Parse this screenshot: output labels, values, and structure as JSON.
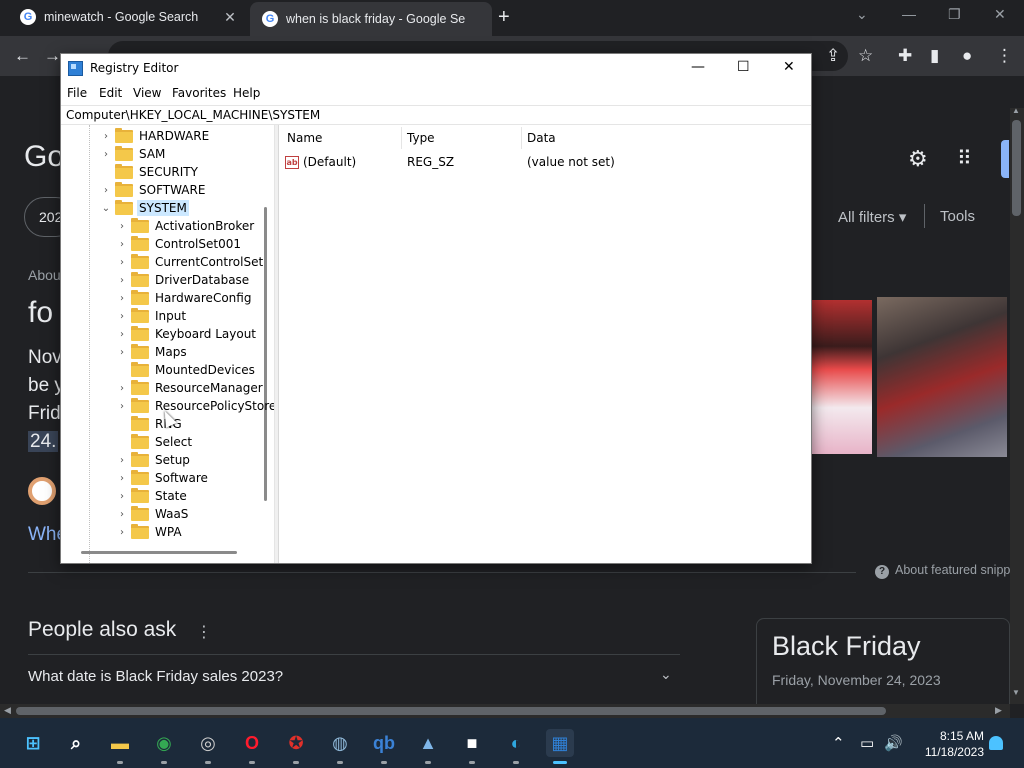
{
  "browser": {
    "tabs": [
      {
        "title": "minewatch - Google Search",
        "favicon": "G"
      },
      {
        "title": "when is black friday - Google Se",
        "favicon": "G"
      }
    ],
    "new_tab": "+",
    "window_controls": {
      "dropdown": "⌄",
      "minimize": "—",
      "restore": "❐",
      "close": "✕"
    },
    "toolbar_icons": {
      "back": "←",
      "forward": "→",
      "share": "⇪",
      "star": "☆",
      "extensions": "✚",
      "sidepanel": "▮",
      "profile": "●",
      "menu": "⋮"
    }
  },
  "google": {
    "logo_fragment": "Go",
    "filter_pill": "202",
    "all_filters": "All filters",
    "tools": "Tools",
    "about_fragment": "Abou",
    "headline_fragment": "fo",
    "snippet_lines": [
      "Nov",
      "be y",
      "Frid"
    ],
    "snippet_date_fragment": "24.",
    "link_fragment": "Whe",
    "about_featured": "About featured snipp",
    "about_featured_icon": "?",
    "people_also_ask": "People also ask",
    "paa_menu": "⋮",
    "question_1": "What date is Black Friday sales 2023?",
    "question_chevron": "⌄",
    "knowledge_title": "Black Friday",
    "knowledge_date": "Friday, November 24, 2023"
  },
  "registry": {
    "title": "Registry Editor",
    "controls": {
      "minimize": "—",
      "maximize": "☐",
      "close": "✕"
    },
    "menu": [
      "File",
      "Edit",
      "View",
      "Favorites",
      "Help"
    ],
    "address": "Computer\\HKEY_LOCAL_MACHINE\\SYSTEM",
    "tree_top": [
      {
        "label": "HARDWARE",
        "expandable": true
      },
      {
        "label": "SAM",
        "expandable": true
      },
      {
        "label": "SECURITY",
        "expandable": false
      },
      {
        "label": "SOFTWARE",
        "expandable": true
      },
      {
        "label": "SYSTEM",
        "expandable": true,
        "expanded": true,
        "selected": true
      }
    ],
    "tree_children": [
      {
        "label": "ActivationBroker",
        "expandable": true
      },
      {
        "label": "ControlSet001",
        "expandable": true
      },
      {
        "label": "CurrentControlSet",
        "expandable": true
      },
      {
        "label": "DriverDatabase",
        "expandable": true
      },
      {
        "label": "HardwareConfig",
        "expandable": true
      },
      {
        "label": "Input",
        "expandable": true
      },
      {
        "label": "Keyboard Layout",
        "expandable": true
      },
      {
        "label": "Maps",
        "expandable": true
      },
      {
        "label": "MountedDevices",
        "expandable": false
      },
      {
        "label": "ResourceManager",
        "expandable": true
      },
      {
        "label": "ResourcePolicyStore",
        "expandable": true
      },
      {
        "label": "RNG",
        "expandable": false
      },
      {
        "label": "Select",
        "expandable": false
      },
      {
        "label": "Setup",
        "expandable": true
      },
      {
        "label": "Software",
        "expandable": true
      },
      {
        "label": "State",
        "expandable": true
      },
      {
        "label": "WaaS",
        "expandable": true
      },
      {
        "label": "WPA",
        "expandable": true
      }
    ],
    "columns": [
      "Name",
      "Type",
      "Data"
    ],
    "values": [
      {
        "name": "(Default)",
        "type": "REG_SZ",
        "data": "(value not set)",
        "icon": "ab"
      }
    ]
  },
  "taskbar": {
    "apps": [
      {
        "name": "start",
        "glyph": "⊞",
        "color": "#4cc2ff"
      },
      {
        "name": "search",
        "glyph": "⌕",
        "color": "#ffffff"
      },
      {
        "name": "file-explorer",
        "glyph": "▬",
        "color": "#f4c84a"
      },
      {
        "name": "chrome",
        "glyph": "◉",
        "color": "#34a853"
      },
      {
        "name": "obs",
        "glyph": "◎",
        "color": "#cccccc"
      },
      {
        "name": "opera",
        "glyph": "O",
        "color": "#ff1b2d"
      },
      {
        "name": "app-red",
        "glyph": "✪",
        "color": "#e0302a"
      },
      {
        "name": "app-globe",
        "glyph": "◍",
        "color": "#8fb8d8"
      },
      {
        "name": "qbittorrent",
        "glyph": "qb",
        "color": "#3b82d6"
      },
      {
        "name": "image-viewer",
        "glyph": "▲",
        "color": "#7fb6e8"
      },
      {
        "name": "package",
        "glyph": "■",
        "color": "#ffffff"
      },
      {
        "name": "edge",
        "glyph": "◐",
        "color": "#2fa8e0"
      },
      {
        "name": "regedit",
        "glyph": "▦",
        "color": "#2f80d6"
      }
    ],
    "tray": {
      "chevron": "⌃",
      "display": "▭",
      "volume": "🔊"
    },
    "time": "8:15 AM",
    "date": "11/18/2023"
  }
}
